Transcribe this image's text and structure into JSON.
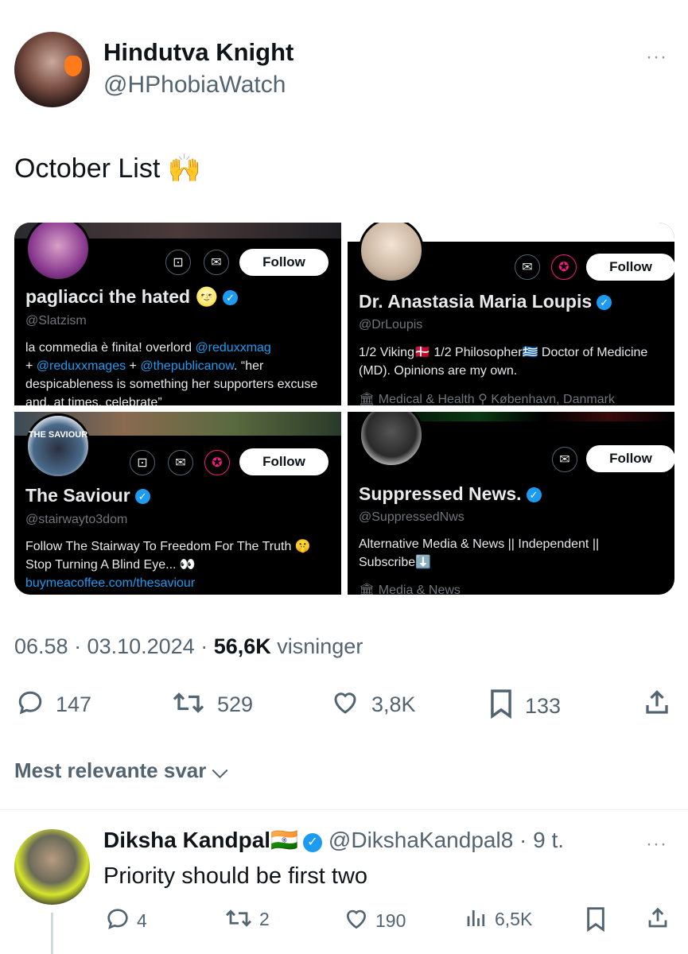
{
  "tweet": {
    "author_name": "Hindutva Knight",
    "author_handle": "@HPhobiaWatch",
    "more": "···",
    "text": "October List 🙌",
    "timestamp": "06.58 · 03.10.2024 · ",
    "views_count": "56,6K",
    "views_label": " visninger",
    "replies": "147",
    "retweets": "529",
    "likes": "3,8K",
    "bookmarks": "133"
  },
  "cards": [
    {
      "name": "pagliacci the hated 🌝",
      "handle": "@Slatzism",
      "follow": "Follow",
      "bio_1": "la commedia è finita! overlord ",
      "bio_link_1": "@reduxxmag",
      "bio_2": "+ ",
      "bio_link_2": "@reduxxmages",
      "bio_3": " + ",
      "bio_link_3": "@thepublicanow",
      "bio_4": ". “her despicableness is something her supporters excuse and, at times, celebrate”"
    },
    {
      "name": "Dr. Anastasia Maria Loupis",
      "handle": "@DrLoupis",
      "follow": "Follow",
      "bio": "1/2 Viking🇩🇰 1/2 Philosopher🇬🇷 Doctor of Medicine (MD). Opinions are my own.",
      "meta": "🏛 Medical & Health   ⚲ København, Danmark"
    },
    {
      "name": "The Saviour",
      "handle": "@stairwayto3dom",
      "follow": "Follow",
      "avatar_text": "THE SAVIOUR",
      "bio": "Follow The Stairway To Freedom For The Truth 🤫 Stop Turning A Blind Eye... 👀",
      "link": "buymeacoffee.com/thesaviour"
    },
    {
      "name": "Suppressed News.",
      "handle": "@SuppressedNws",
      "follow": "Follow",
      "bio": "Alternative Media & News || Independent || Subscribe⬇️",
      "meta": "🏛 Media & News"
    }
  ],
  "sort_label": "Mest relevante svar",
  "reply": {
    "name": "Diksha Kandpal🇮🇳",
    "handle_time": "@DikshaKandpal8 · 9 t.",
    "more": "···",
    "text": "Priority should be first two",
    "replies": "4",
    "retweets": "2",
    "likes": "190",
    "views": "6,5K"
  },
  "icons": [
    "more-icon",
    "subscribe-icon",
    "mail-icon",
    "creator-icon",
    "verified-icon",
    "reply-icon",
    "retweet-icon",
    "like-icon",
    "bookmark-icon",
    "share-icon",
    "views-icon",
    "chevron-down-icon"
  ],
  "colors": {
    "accent": "#1d9bf0",
    "text": "#0f1419",
    "muted": "#536471",
    "card_bg": "#000000"
  }
}
